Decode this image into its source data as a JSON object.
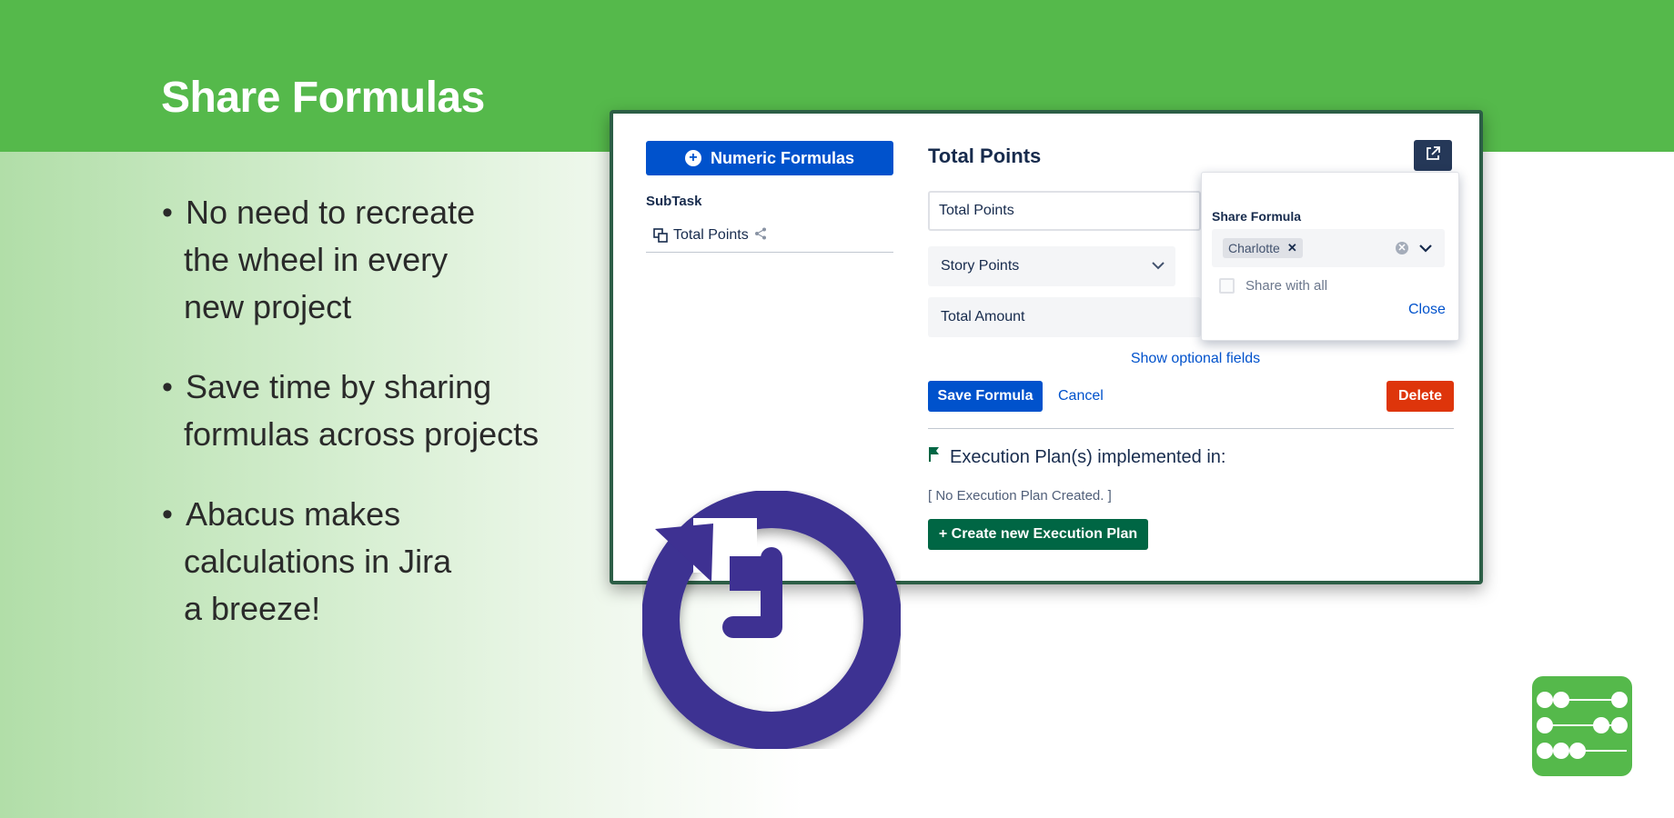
{
  "slide": {
    "title": "Share Formulas",
    "bullets": [
      {
        "lines": [
          "No need to recreate",
          "the wheel in every",
          "new project"
        ]
      },
      {
        "lines": [
          "Save time by sharing",
          "formulas across projects"
        ]
      },
      {
        "lines": [
          "Abacus makes",
          "calculations in Jira",
          "a breeze!"
        ]
      }
    ]
  },
  "app": {
    "sidebar": {
      "numeric_formulas_label": "Numeric Formulas",
      "section_label": "SubTask",
      "formula_item_label": "Total Points"
    },
    "main": {
      "title": "Total Points",
      "name_value": "Total Points",
      "select_value": "Story Points",
      "amount_value": "Total Amount",
      "show_optional_label": "Show optional fields",
      "save_label": "Save Formula",
      "cancel_label": "Cancel",
      "delete_label": "Delete",
      "execution_title": "Execution Plan(s) implemented in:",
      "no_execution_text": "[ No Execution Plan Created. ]",
      "create_plan_label": "+ Create new Execution Plan"
    },
    "share_popup": {
      "label": "Share Formula",
      "selected_user": "Charlotte",
      "share_all_label": "Share with all",
      "close_label": "Close"
    }
  },
  "colors": {
    "brand_green": "#55b94b",
    "primary_blue": "#0052cc",
    "danger_red": "#de350b",
    "success_green": "#006644",
    "clock_purple": "#3e3192"
  }
}
